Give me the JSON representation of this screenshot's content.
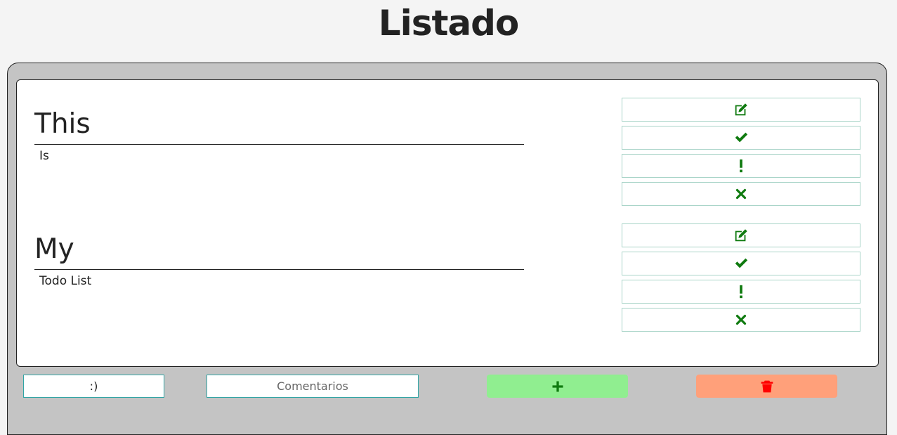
{
  "page": {
    "title": "Listado"
  },
  "todos": [
    {
      "title": "This",
      "body": "Is"
    },
    {
      "title": "My",
      "body": "Todo List"
    }
  ],
  "actions": [
    "edit-icon",
    "check-icon",
    "exclamation-icon",
    "times-icon"
  ],
  "bottom": {
    "title_value": ":)",
    "comments_placeholder": "Comentarios",
    "add_icon": "plus-icon",
    "delete_icon": "trash-icon"
  },
  "colors": {
    "background": "#f4f4f4",
    "frame": "#c4c4c4",
    "icon_green": "#0f7a0f",
    "add_button": "#90ee90",
    "delete_button": "#ffa07a",
    "delete_icon": "#ff0000",
    "field_border": "#2fa5a5"
  }
}
